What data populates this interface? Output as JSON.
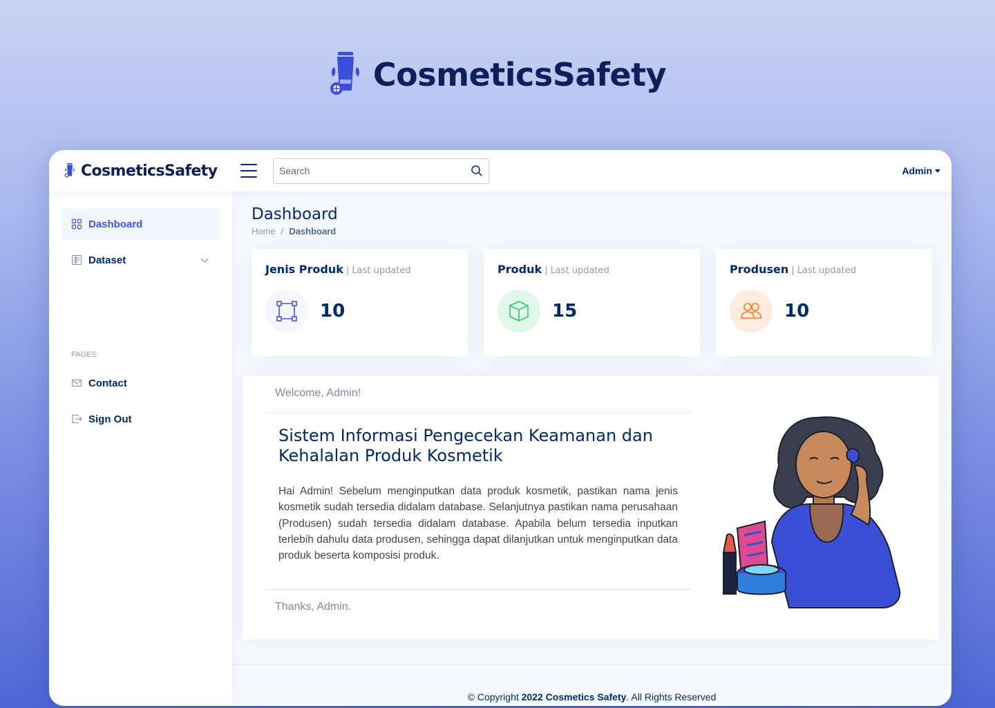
{
  "hero": {
    "title": "CosmeticsSafety"
  },
  "topbar": {
    "brand": "CosmeticsSafety",
    "search_placeholder": "Search",
    "user_label": "Admin"
  },
  "sidebar": {
    "items": [
      {
        "label": "Dashboard",
        "icon": "grid-icon",
        "active": true
      },
      {
        "label": "Dataset",
        "icon": "layout-text-icon",
        "active": false
      }
    ],
    "pages_heading": "PAGES",
    "pages": [
      {
        "label": "Contact",
        "icon": "envelope-icon"
      },
      {
        "label": "Sign Out",
        "icon": "box-arrow-right-icon"
      }
    ]
  },
  "main": {
    "title": "Dashboard",
    "breadcrumb": [
      "Home",
      "Dashboard"
    ],
    "cards": [
      {
        "title": "Jenis Produk",
        "subtitle": "| Last updated",
        "value": "10",
        "icon": "bounding-box-icon",
        "color": "#4154f1",
        "bg": "#f6f6fe"
      },
      {
        "title": "Produk",
        "subtitle": "| Last updated",
        "value": "15",
        "icon": "box-icon",
        "color": "#2eca6a",
        "bg": "#e0f8e9"
      },
      {
        "title": "Produsen",
        "subtitle": "| Last updated",
        "value": "10",
        "icon": "people-icon",
        "color": "#ff771d",
        "bg": "#ffecdf"
      }
    ],
    "welcome": {
      "header": "Welcome, Admin!",
      "title": "Sistem Informasi Pengecekan Keamanan dan Kehalalan Produk Kosmetik",
      "text": "Hai Admin! Sebelum menginputkan data produk kosmetik, pastikan nama jenis kosmetik sudah tersedia didalam database. Selanjutnya pastikan nama perusahaan (Produsen) sudah tersedia didalam database. Apabila belum tersedia inputkan terlebih dahulu data produsen, sehingga dapat dilanjutkan untuk menginputkan data produk beserta komposisi produk.",
      "footer": "Thanks, Admin."
    }
  },
  "footer": {
    "prefix": "© Copyright",
    "bold": "2022 Cosmetics Safety",
    "suffix": ". All Rights Reserved"
  }
}
